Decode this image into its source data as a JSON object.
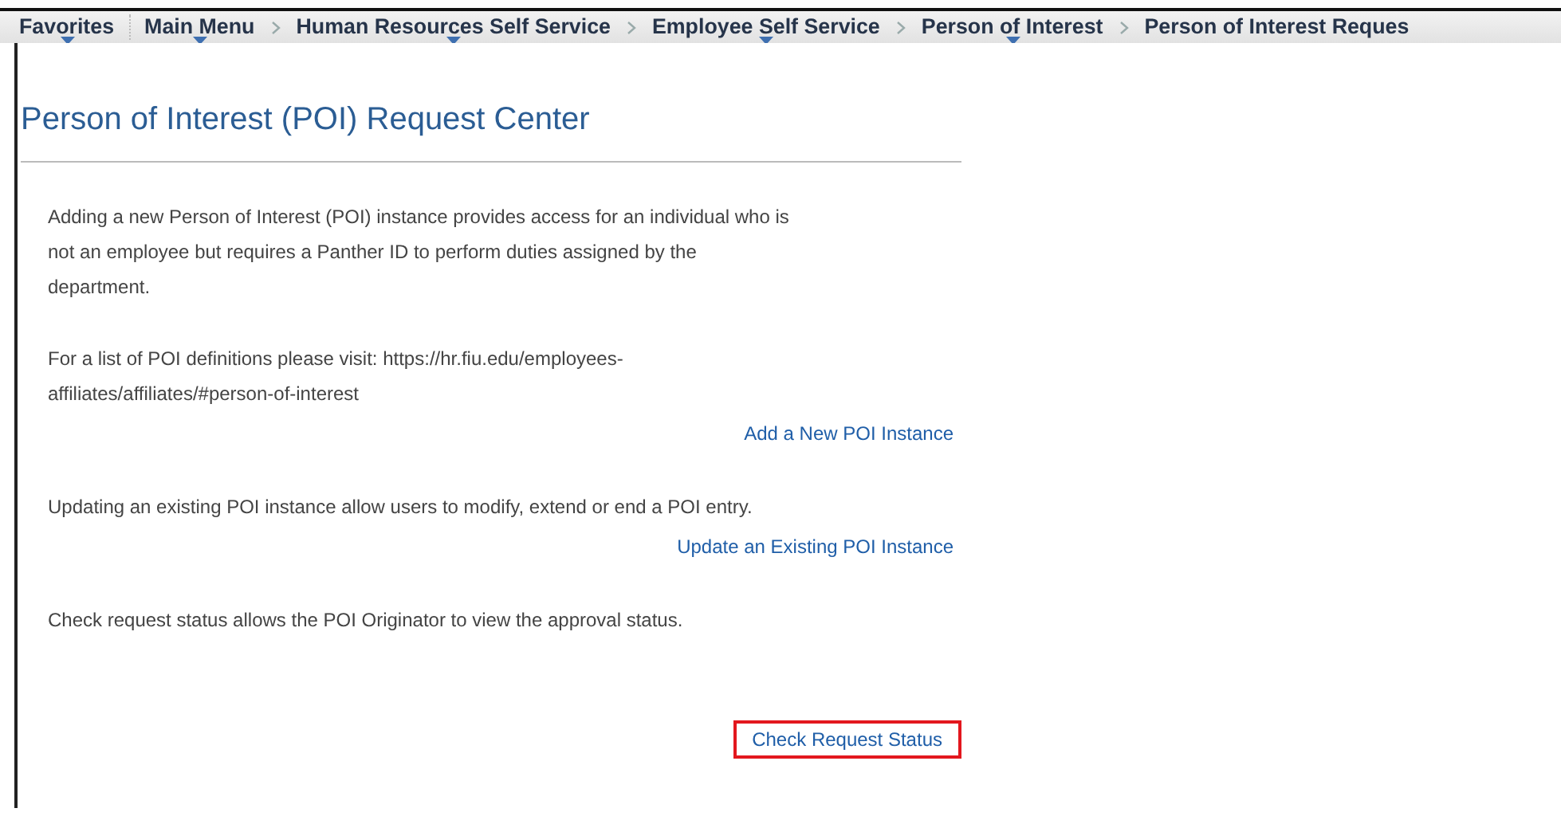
{
  "breadcrumbs": [
    {
      "label": "Favorites",
      "dropdown": true
    },
    {
      "label": "Main Menu",
      "dropdown": true
    },
    {
      "label": "Human Resources Self Service",
      "dropdown": true
    },
    {
      "label": "Employee Self Service",
      "dropdown": true
    },
    {
      "label": "Person of Interest",
      "dropdown": true
    },
    {
      "label": "Person of Interest Reques",
      "dropdown": false
    }
  ],
  "page_title": "Person of Interest (POI) Request Center",
  "blocks": [
    {
      "kind": "text",
      "text": "Adding a new Person of Interest (POI) instance provides access for an individual who is not an employee but requires a Panther ID to perform duties assigned by the department."
    },
    {
      "kind": "text",
      "text": "For a list of POI definitions please visit: https://hr.fiu.edu/employees-affiliates/affiliates/#person-of-interest"
    },
    {
      "kind": "link",
      "text": "Add a New POI Instance",
      "highlighted": false
    },
    {
      "kind": "text",
      "text": "Updating an existing POI instance allow users to modify, extend or end a POI entry."
    },
    {
      "kind": "link",
      "text": "Update an Existing POI Instance",
      "highlighted": false
    },
    {
      "kind": "text",
      "text": "Check request status allows the POI Originator to view the approval status."
    },
    {
      "kind": "link",
      "text": "Check Request Status",
      "highlighted": true
    }
  ]
}
